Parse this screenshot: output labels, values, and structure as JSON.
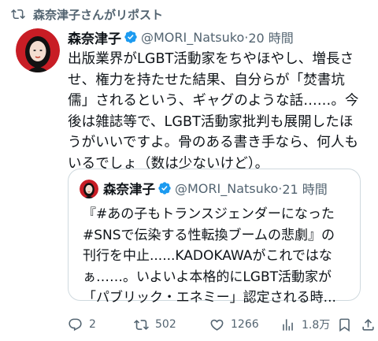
{
  "repost": {
    "label": "森奈津子さんがリポスト"
  },
  "tweet": {
    "author_name": "森奈津子",
    "handle": "@MORI_Natsuko",
    "separator": "·",
    "time": "20 時間",
    "lines": [
      "出版業界がLGBT活動家をちやほやし、増長さ",
      "せ、権力を持たせた結果、自分らが「焚書坑",
      "儒」されるという、ギャグのような話……。今",
      "後は雑誌等で、LGBT活動家批判も展開したほ",
      "うがいいですよ。骨のある書き手なら、何人も",
      "いるでしょ（数は少ないけど）。"
    ]
  },
  "quote": {
    "author_name": "森奈津子",
    "handle": "@MORI_Natsuko",
    "separator": "·",
    "time": "21 時間",
    "lines": [
      "『#あの子もトランスジェンダーになった",
      "#SNSで伝染する性転換ブームの悲劇』の",
      "刊行を中止......KADOKAWAがこれではな",
      "ぁ……。いよいよ本格的にLGBT活動家が",
      "「パブリック・エネミー」認定される時..."
    ]
  },
  "actions": {
    "replies": "2",
    "reposts": "502",
    "likes": "1266",
    "views": "1.8万"
  },
  "colors": {
    "text": "#0f1419",
    "muted": "#536471",
    "verified": "#1d9bf0",
    "border": "#cfd9de"
  }
}
